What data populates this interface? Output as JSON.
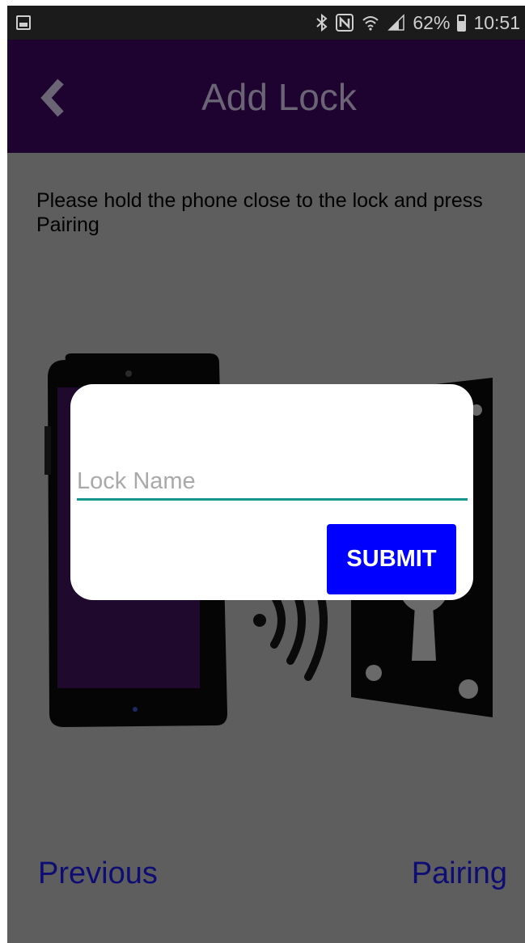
{
  "status_bar": {
    "battery_percent": "62%",
    "time": "10:51",
    "icons": [
      "gallery-icon",
      "bluetooth-icon",
      "nfc-icon",
      "wifi-icon",
      "signal-icon",
      "battery-icon"
    ]
  },
  "app_bar": {
    "title": "Add Lock",
    "back_icon": "chevron-left-icon"
  },
  "instruction": "Please hold the phone close to the lock and press Pairing",
  "illustration": {
    "icons": [
      "phone-icon",
      "wireless-signal-icon",
      "lock-door-icon"
    ]
  },
  "dialog": {
    "input_placeholder": "Lock Name",
    "input_value": "",
    "submit_label": "SUBMIT"
  },
  "footer": {
    "previous_label": "Previous",
    "pairing_label": "Pairing"
  },
  "colors": {
    "app_bar": "#1e0330",
    "scrim_background": "#5e5e5e",
    "input_underline": "#17968c",
    "submit_button": "#0000ff",
    "nav_link": "#0d0d74"
  }
}
